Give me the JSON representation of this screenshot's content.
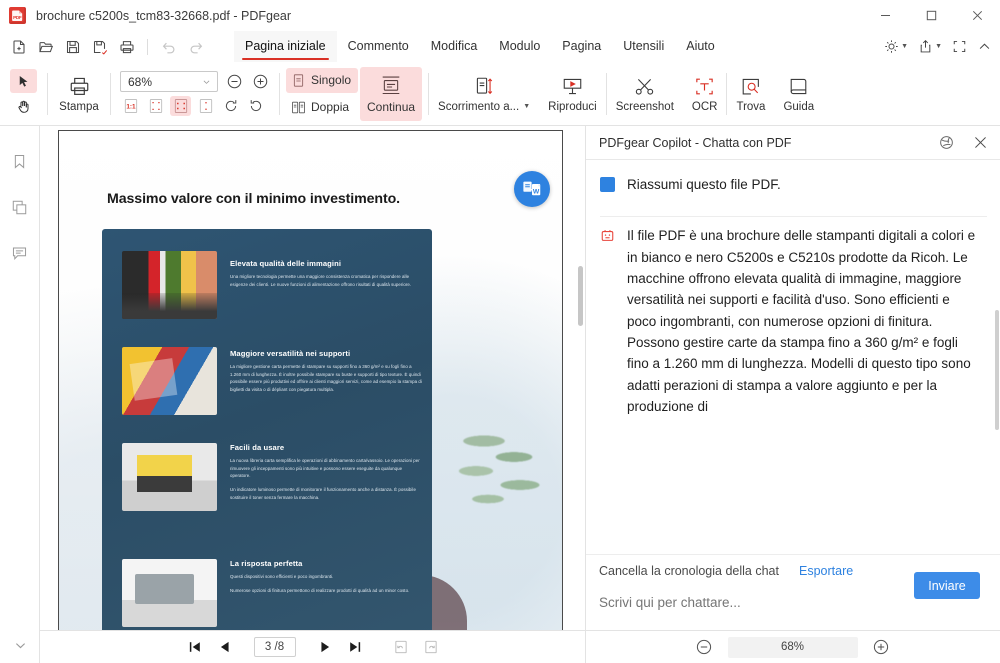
{
  "window": {
    "title": "brochure c5200s_tcm83-32668.pdf - PDFgear",
    "logo_text": "PDF",
    "minimize": "minimize-icon",
    "maximize": "maximize-icon",
    "close": "close-icon"
  },
  "quick_access": [
    {
      "name": "new-file",
      "icon": "file-plus-icon"
    },
    {
      "name": "open-file",
      "icon": "folder-open-icon"
    },
    {
      "name": "save",
      "icon": "save-icon"
    },
    {
      "name": "save-as",
      "icon": "save-as-icon"
    },
    {
      "name": "print",
      "icon": "printer-icon"
    },
    {
      "name": "undo",
      "icon": "undo-icon"
    },
    {
      "name": "redo",
      "icon": "redo-icon"
    }
  ],
  "tabs": [
    {
      "label": "Pagina iniziale",
      "active": true
    },
    {
      "label": "Commento",
      "active": false
    },
    {
      "label": "Modifica",
      "active": false
    },
    {
      "label": "Modulo",
      "active": false
    },
    {
      "label": "Pagina",
      "active": false
    },
    {
      "label": "Utensili",
      "active": false
    },
    {
      "label": "Aiuto",
      "active": false
    }
  ],
  "menubar_right": [
    {
      "name": "theme-brightness",
      "icon": "sun-icon",
      "has_caret": true
    },
    {
      "name": "share-export",
      "icon": "share-upload-icon",
      "has_caret": true
    },
    {
      "name": "fullscreen",
      "icon": "fullscreen-icon",
      "has_caret": false
    },
    {
      "name": "collapse-ribbon",
      "icon": "chevron-up-icon",
      "has_caret": false
    }
  ],
  "ribbon": {
    "select_tool": "cursor-arrow-icon",
    "hand_tool": "hand-icon",
    "print_label": "Stampa",
    "zoom_value": "68%",
    "zoom_out": "minus-circle-icon",
    "zoom_in": "plus-circle-icon",
    "fit_buttons": [
      {
        "name": "actual-size",
        "label": "1:1",
        "selected": false
      },
      {
        "name": "fit-page",
        "label": "fit-page-icon",
        "selected": false
      },
      {
        "name": "fit-width",
        "label": "fit-width-icon",
        "selected": true
      },
      {
        "name": "fit-visible",
        "label": "fit-visible-icon",
        "selected": false
      }
    ],
    "rotate_right": "rotate-cw-icon",
    "rotate_left": "rotate-ccw-icon",
    "single_label": "Singolo",
    "double_label": "Doppia",
    "continuous_label": "Continua",
    "scroll_label": "Scorrimento a...",
    "play_label": "Riproduci",
    "screenshot_label": "Screenshot",
    "ocr_label": "OCR",
    "find_label": "Trova",
    "guide_label": "Guida"
  },
  "left_rail": [
    {
      "name": "bookmarks-panel",
      "icon": "bookmark-icon"
    },
    {
      "name": "thumbnails-panel",
      "icon": "pages-icon"
    },
    {
      "name": "comments-panel",
      "icon": "comment-icon"
    }
  ],
  "left_rail_bottom": {
    "name": "expand-panel",
    "icon": "chevron-down-icon"
  },
  "document": {
    "convert_fab": "convert-to-word-icon",
    "heading": "Massimo valore con il minimo investimento.",
    "sections": [
      {
        "title": "Elevata qualità delle immagini",
        "paragraphs": [
          "Una migliore tecnologia permette una maggiore consistenza cromatica per rispondere alle esigenze dei clienti. Le nuove funzioni di alimentazione offrono risultati di qualità superiore."
        ]
      },
      {
        "title": "Maggiore versatilità nei supporti",
        "paragraphs": [
          "La migliore gestione carta permette di stampare su supporti fino a 360 g/m² e su fogli fino a 1.260 mm di lunghezza. È inoltre possibile stampare su buste e supporti di tipo texture. È quindi possibile essere più produttivi ed offrire ai clienti maggiori servizi, come ad esempio la stampa di biglietti da visita o di dépliant con piegatura multipla."
        ]
      },
      {
        "title": "Facili da usare",
        "paragraphs": [
          "La nuova libreria carta semplifica le operazioni di abbinamento carta/vassoio. Le operazioni per rimuovere gli inceppamenti sono più intuitive e possono essere eseguite da qualunque operatore.",
          "Un indicatore luminoso permette di monitorare il funzionamento anche a distanza. È possibile sostituire il toner senza fermare la macchina."
        ]
      },
      {
        "title": "La risposta perfetta",
        "paragraphs": [
          "Questi dispositivi sono efficienti e poco ingombranti.",
          "Numerose opzioni di finitura permettono di realizzare prodotti di qualità ad un minor costo."
        ]
      }
    ]
  },
  "bottom_nav": {
    "first_page": "first-page-icon",
    "prev_page": "previous-page-icon",
    "page_indicator": "3 /8",
    "next_page": "next-page-icon",
    "last_page": "last-page-icon",
    "undo_view": "undo-view-icon",
    "redo_view": "redo-view-icon",
    "zoom_out": "minus-circle-icon",
    "zoom_value": "68%",
    "zoom_in": "plus-circle-icon"
  },
  "copilot": {
    "title": "PDFgear Copilot - Chatta con PDF",
    "refresh_icon": "refresh-chat-icon",
    "close_icon": "close-icon",
    "messages": [
      {
        "role": "user",
        "avatar": "user-avatar",
        "text": "Riassumi questo file PDF."
      },
      {
        "role": "assistant",
        "avatar": "pdfgear-bot-avatar",
        "text": "Il file PDF è una brochure delle stampanti digitali a colori e in bianco e nero C5200s e C5210s prodotte da Ricoh. Le macchine offrono elevata qualità di immagine, maggiore versatilità nei supporti e facilità d'uso. Sono efficienti e poco ingombranti, con numerose opzioni di finitura. Possono gestire carte da stampa fino a 360 g/m² e fogli fino a 1.260 mm di lunghezza. Modelli di questo tipo sono adatti perazioni di stampa a valore aggiunto e per la produzione di"
      }
    ],
    "clear_history": "Cancella la cronologia della chat",
    "export": "Esportare",
    "input_placeholder": "Scrivi qui per chattare...",
    "send_label": "Inviare"
  },
  "colors": {
    "accent_red": "#d93025",
    "selection_pink": "#fbdcdc",
    "accent_blue": "#2e82e0",
    "send_blue": "#3d8ce8",
    "card_blue": "#2b4d66"
  }
}
